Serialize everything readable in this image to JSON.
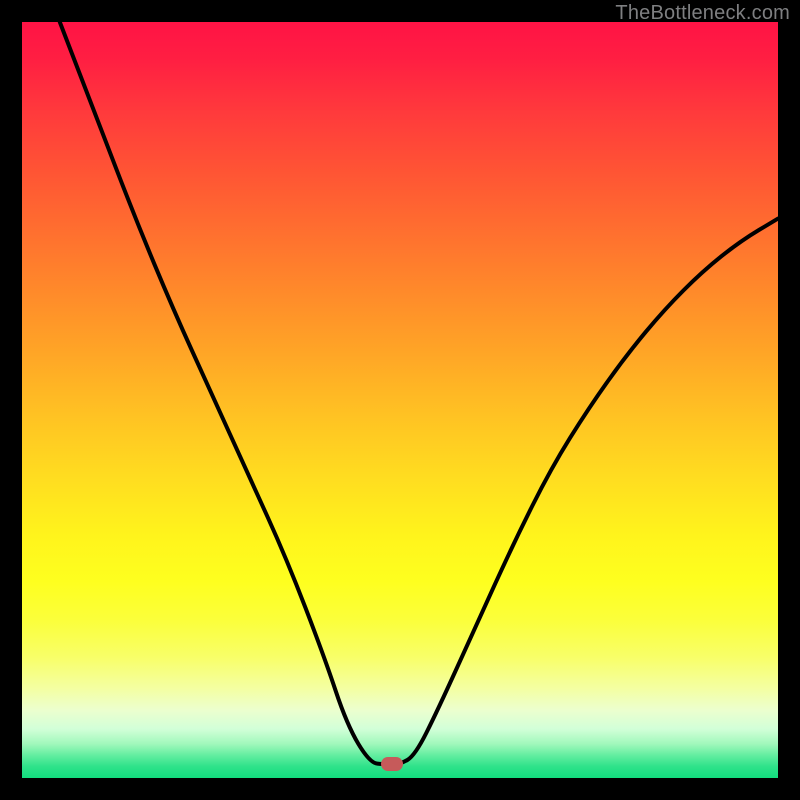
{
  "attribution": "TheBottleneck.com",
  "colors": {
    "attribution_text": "#7e7f81",
    "marker_fill": "#c65a5a",
    "curve_stroke": "#000000"
  },
  "marker": {
    "x_frac": 0.49,
    "y_frac": 0.982
  },
  "chart_data": {
    "type": "line",
    "title": "",
    "xlabel": "",
    "ylabel": "",
    "xlim": [
      0,
      100
    ],
    "ylim": [
      0,
      100
    ],
    "series": [
      {
        "name": "bottleneck-curve",
        "x": [
          5,
          10,
          15,
          20,
          25,
          30,
          35,
          40,
          43,
          46,
          48,
          50,
          52,
          55,
          60,
          65,
          70,
          75,
          80,
          85,
          90,
          95,
          100
        ],
        "y": [
          100,
          87,
          74,
          62,
          51,
          40,
          29,
          16,
          7,
          2,
          1.8,
          1.8,
          3,
          9,
          20,
          31,
          41,
          49,
          56,
          62,
          67,
          71,
          74
        ]
      }
    ],
    "annotations": [
      {
        "type": "marker",
        "x": 49,
        "y": 1.8,
        "label": "optimal-point"
      }
    ],
    "background": "vertical-gradient red→yellow→green (bottleneck severity scale)"
  }
}
